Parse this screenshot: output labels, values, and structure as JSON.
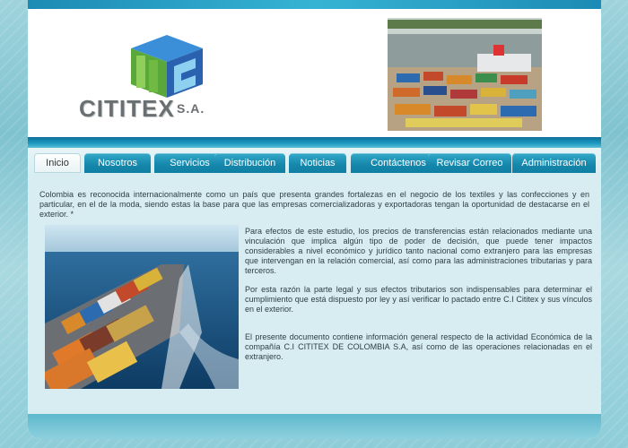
{
  "header": {
    "company_name": "CITITEX",
    "company_suffix": "S.A."
  },
  "nav": {
    "tabs": [
      {
        "label": "Inicio",
        "active": true
      },
      {
        "label": "Nosotros"
      },
      {
        "label": "Servicios"
      },
      {
        "label": "Distribución"
      },
      {
        "label": "Noticias"
      },
      {
        "label": "Contáctenos"
      },
      {
        "label": "Revisar Correo"
      },
      {
        "label": "Administración"
      }
    ]
  },
  "main": {
    "intro": "Colombia es reconocida internacionalmente como un país que presenta grandes fortalezas en el negocio de los textiles y las confecciones y en particular, en el de la moda, siendo estas  la base para que las  empresas comercializadoras y exportadoras tengan la oportunidad de destacarse en el exterior. *",
    "paragraphs": [
      "Para efectos de este estudio, los precios de transferencias están relacionados mediante una vinculación que implica algún tipo de poder de decisión, que puede tener impactos considerables a nivel económico y jurídico tanto nacional como extranjero para las empresas que intervengan en la relación comercial, así como para las administraciones tributarias y para terceros.",
      "Por esta razón la parte  legal y sus efectos tributarios son indispensables para determinar el cumplimiento que está dispuesto por ley y así verificar  lo pactado entre C.I Cititex y sus  vínculos en el exterior.",
      "El presente documento contiene información general respecto de la actividad Económica  de la compañía C.I CITITEX DE COLOMBIA S.A, así como de las operaciones  relacionadas en el extranjero."
    ]
  },
  "colors": {
    "tab": "#1789ad",
    "band": "#0c6f9a",
    "panel": "#d8edf1",
    "logo_blue": "#2f6fb5",
    "logo_green": "#7cbf3a"
  }
}
